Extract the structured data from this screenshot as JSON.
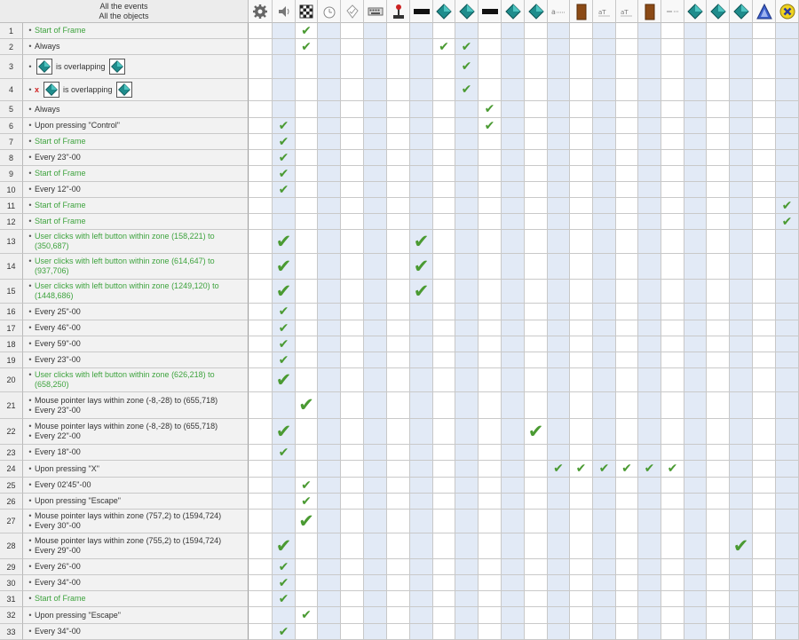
{
  "header": {
    "line1": "All the events",
    "line2": "All the objects"
  },
  "columns": [
    {
      "icon": "gear-icon"
    },
    {
      "icon": "speaker-icon"
    },
    {
      "icon": "checkerboard-icon"
    },
    {
      "icon": "timer-icon"
    },
    {
      "icon": "shield-icon"
    },
    {
      "icon": "keyboard-icon"
    },
    {
      "icon": "joystick-icon"
    },
    {
      "icon": "black-bar-icon"
    },
    {
      "icon": "teal-diamond-icon"
    },
    {
      "icon": "teal-diamond-icon"
    },
    {
      "icon": "black-bar-icon"
    },
    {
      "icon": "teal-diamond-icon"
    },
    {
      "icon": "teal-diamond-icon"
    },
    {
      "icon": "string-icon"
    },
    {
      "icon": "brown-door-icon"
    },
    {
      "icon": "text-small-icon"
    },
    {
      "icon": "text-small-icon"
    },
    {
      "icon": "brown-door-icon"
    },
    {
      "icon": "dash-text-icon"
    },
    {
      "icon": "teal-diamond-icon"
    },
    {
      "icon": "teal-diamond-icon"
    },
    {
      "icon": "teal-diamond-icon"
    },
    {
      "icon": "blue-triangle-icon"
    },
    {
      "icon": "yellow-x-circle-icon"
    }
  ],
  "check_symbol": "✔",
  "rows": [
    {
      "num": "1",
      "conditions": [
        {
          "text": "Start of Frame",
          "green": true
        }
      ],
      "checks": [
        2
      ]
    },
    {
      "num": "2",
      "conditions": [
        {
          "text": "Always"
        }
      ],
      "checks": [
        2,
        8,
        9
      ]
    },
    {
      "num": "3",
      "conditions": [
        {
          "pre_icon": true,
          "text": "is overlapping",
          "post_icon": true
        }
      ],
      "checks": [
        9
      ]
    },
    {
      "num": "4",
      "conditions": [
        {
          "negated": "x",
          "pre_icon": true,
          "text": "is overlapping",
          "post_icon": true
        }
      ],
      "checks": [
        9
      ]
    },
    {
      "num": "5",
      "conditions": [
        {
          "text": "Always"
        }
      ],
      "checks": [
        10
      ]
    },
    {
      "num": "6",
      "conditions": [
        {
          "text": "Upon pressing \"Control\""
        }
      ],
      "checks": [
        1,
        10
      ]
    },
    {
      "num": "7",
      "conditions": [
        {
          "text": "Start of Frame",
          "green": true
        }
      ],
      "checks": [
        1
      ]
    },
    {
      "num": "8",
      "conditions": [
        {
          "text": "Every 23\"-00"
        }
      ],
      "checks": [
        1
      ]
    },
    {
      "num": "9",
      "conditions": [
        {
          "text": "Start of Frame",
          "green": true
        }
      ],
      "checks": [
        1
      ]
    },
    {
      "num": "10",
      "conditions": [
        {
          "text": "Every 12\"-00"
        }
      ],
      "checks": [
        1
      ]
    },
    {
      "num": "11",
      "conditions": [
        {
          "text": "Start of Frame",
          "green": true
        }
      ],
      "checks": [
        23
      ]
    },
    {
      "num": "12",
      "conditions": [
        {
          "text": "Start of Frame",
          "green": true
        }
      ],
      "checks": [
        23
      ]
    },
    {
      "num": "13",
      "conditions": [
        {
          "text": "User clicks with left button within zone (158,221) to",
          "green": true
        },
        {
          "text": "(350,687)",
          "green": true,
          "cont": true
        }
      ],
      "checks": [
        1,
        7
      ]
    },
    {
      "num": "14",
      "conditions": [
        {
          "text": "User clicks with left button within zone (614,647) to",
          "green": true
        },
        {
          "text": "(937,706)",
          "green": true,
          "cont": true
        }
      ],
      "checks": [
        1,
        7
      ]
    },
    {
      "num": "15",
      "conditions": [
        {
          "text": "User clicks with left button within zone (1249,120) to",
          "green": true
        },
        {
          "text": "(1448,686)",
          "green": true,
          "cont": true
        }
      ],
      "checks": [
        1,
        7
      ]
    },
    {
      "num": "16",
      "conditions": [
        {
          "text": "Every 25\"-00"
        }
      ],
      "checks": [
        1
      ]
    },
    {
      "num": "17",
      "conditions": [
        {
          "text": "Every 46\"-00"
        }
      ],
      "checks": [
        1
      ]
    },
    {
      "num": "18",
      "conditions": [
        {
          "text": "Every 59\"-00"
        }
      ],
      "checks": [
        1
      ]
    },
    {
      "num": "19",
      "conditions": [
        {
          "text": "Every 23\"-00"
        }
      ],
      "checks": [
        1
      ]
    },
    {
      "num": "20",
      "conditions": [
        {
          "text": "User clicks with left button within zone (626,218) to",
          "green": true
        },
        {
          "text": "(658,250)",
          "green": true,
          "cont": true
        }
      ],
      "checks": [
        1
      ]
    },
    {
      "num": "21",
      "conditions": [
        {
          "text": "Mouse pointer lays within zone (-8,-28) to (655,718)"
        },
        {
          "text": "Every 23\"-00"
        }
      ],
      "checks": [
        2
      ]
    },
    {
      "num": "22",
      "conditions": [
        {
          "text": "Mouse pointer lays within zone (-8,-28) to (655,718)"
        },
        {
          "text": "Every 22\"-00"
        }
      ],
      "checks": [
        1,
        12
      ]
    },
    {
      "num": "23",
      "conditions": [
        {
          "text": "Every 18\"-00"
        }
      ],
      "checks": [
        1
      ]
    },
    {
      "num": "24",
      "conditions": [
        {
          "text": "Upon pressing \"X\""
        }
      ],
      "checks": [
        13,
        14,
        15,
        16,
        17,
        18
      ]
    },
    {
      "num": "25",
      "conditions": [
        {
          "text": "Every 02'45\"-00"
        }
      ],
      "checks": [
        2
      ]
    },
    {
      "num": "26",
      "conditions": [
        {
          "text": "Upon pressing \"Escape\""
        }
      ],
      "checks": [
        2
      ]
    },
    {
      "num": "27",
      "conditions": [
        {
          "text": "Mouse pointer lays within zone (757,2) to (1594,724)"
        },
        {
          "text": "Every 30\"-00"
        }
      ],
      "checks": [
        2
      ]
    },
    {
      "num": "28",
      "conditions": [
        {
          "text": "Mouse pointer lays within zone (755,2) to (1594,724)"
        },
        {
          "text": "Every 29\"-00"
        }
      ],
      "checks": [
        1,
        21
      ]
    },
    {
      "num": "29",
      "conditions": [
        {
          "text": "Every 26\"-00"
        }
      ],
      "checks": [
        1
      ]
    },
    {
      "num": "30",
      "conditions": [
        {
          "text": "Every 34\"-00"
        }
      ],
      "checks": [
        1
      ]
    },
    {
      "num": "31",
      "conditions": [
        {
          "text": "Start of Frame",
          "green": true
        }
      ],
      "checks": [
        1
      ]
    },
    {
      "num": "32",
      "conditions": [
        {
          "text": "Upon pressing \"Escape\""
        }
      ],
      "checks": [
        2
      ]
    },
    {
      "num": "33",
      "conditions": [
        {
          "text": "Every 34\"-00"
        }
      ],
      "checks": [
        1
      ]
    }
  ]
}
